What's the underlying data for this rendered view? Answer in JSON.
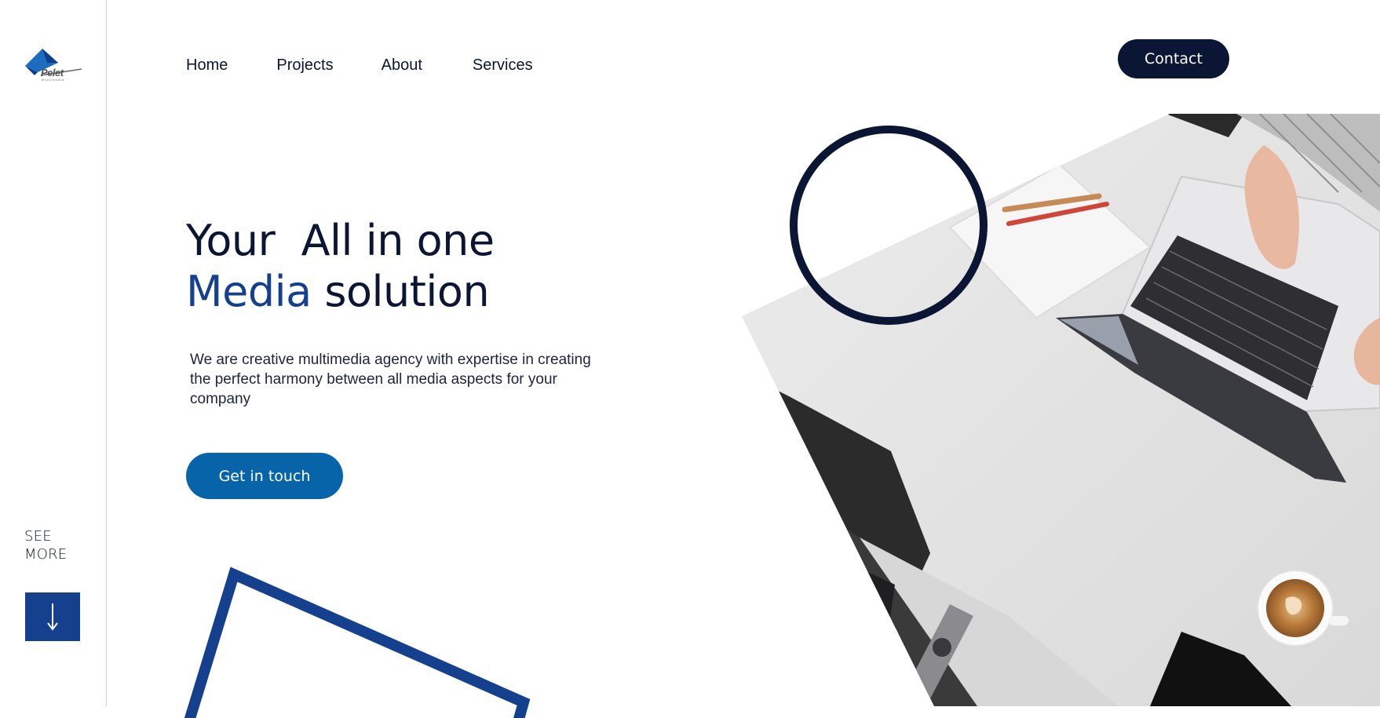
{
  "brand": {
    "logo_text": "Pelet",
    "logo_subtext": "multimedia",
    "primary_color": "#0a1633",
    "accent_color": "#14408d",
    "button_color": "#0864a8"
  },
  "nav": {
    "items": [
      {
        "label": "Home"
      },
      {
        "label": "Projects"
      },
      {
        "label": "About"
      },
      {
        "label": "Services"
      }
    ],
    "contact_label": "Contact"
  },
  "hero": {
    "title_line1": "Your  All in one",
    "title_accent": "Media",
    "title_rest": " solution",
    "description": "We are creative multimedia agency with expertise in creating the perfect harmony between all media aspects for your company",
    "cta_label": "Get in touch"
  },
  "sidebar": {
    "see_more_line1": "SEE",
    "see_more_line2": "MORE",
    "scroll_icon": "arrow-down-icon"
  },
  "image": {
    "subject": "office-desk-laptop-photo"
  }
}
